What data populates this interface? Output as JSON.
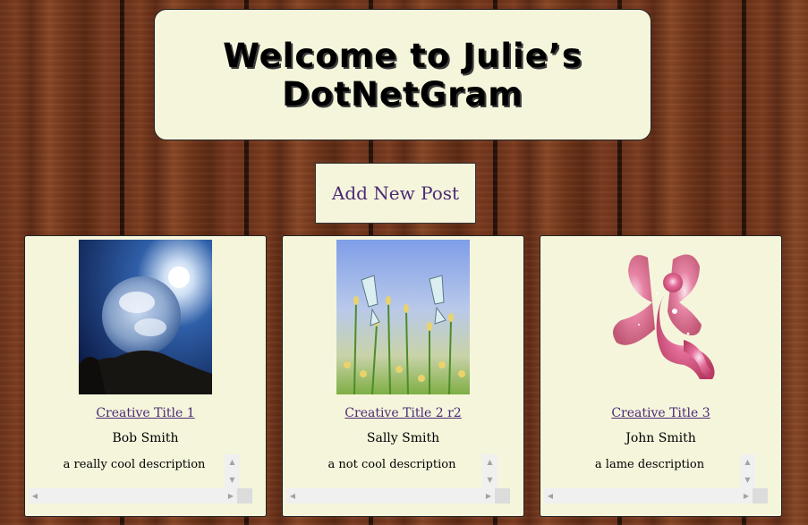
{
  "header": {
    "title": "Welcome to Julie’s DotNetGram"
  },
  "actions": {
    "add_post_label": "Add New Post"
  },
  "posts": [
    {
      "title": "Creative Title 1",
      "author": "Bob Smith",
      "description": "a really cool description",
      "image": "crystal-ball-photo"
    },
    {
      "title": "Creative Title 2 r2",
      "author": "Sally Smith",
      "description": "a not cool description",
      "image": "butterflies-photo"
    },
    {
      "title": "Creative Title 3",
      "author": "John Smith",
      "description": "a lame description",
      "image": "galaxy-fairy-image"
    }
  ],
  "colors": {
    "panel": "#f5f5dc",
    "link": "#4b2a73",
    "wood": "#6a321a"
  }
}
